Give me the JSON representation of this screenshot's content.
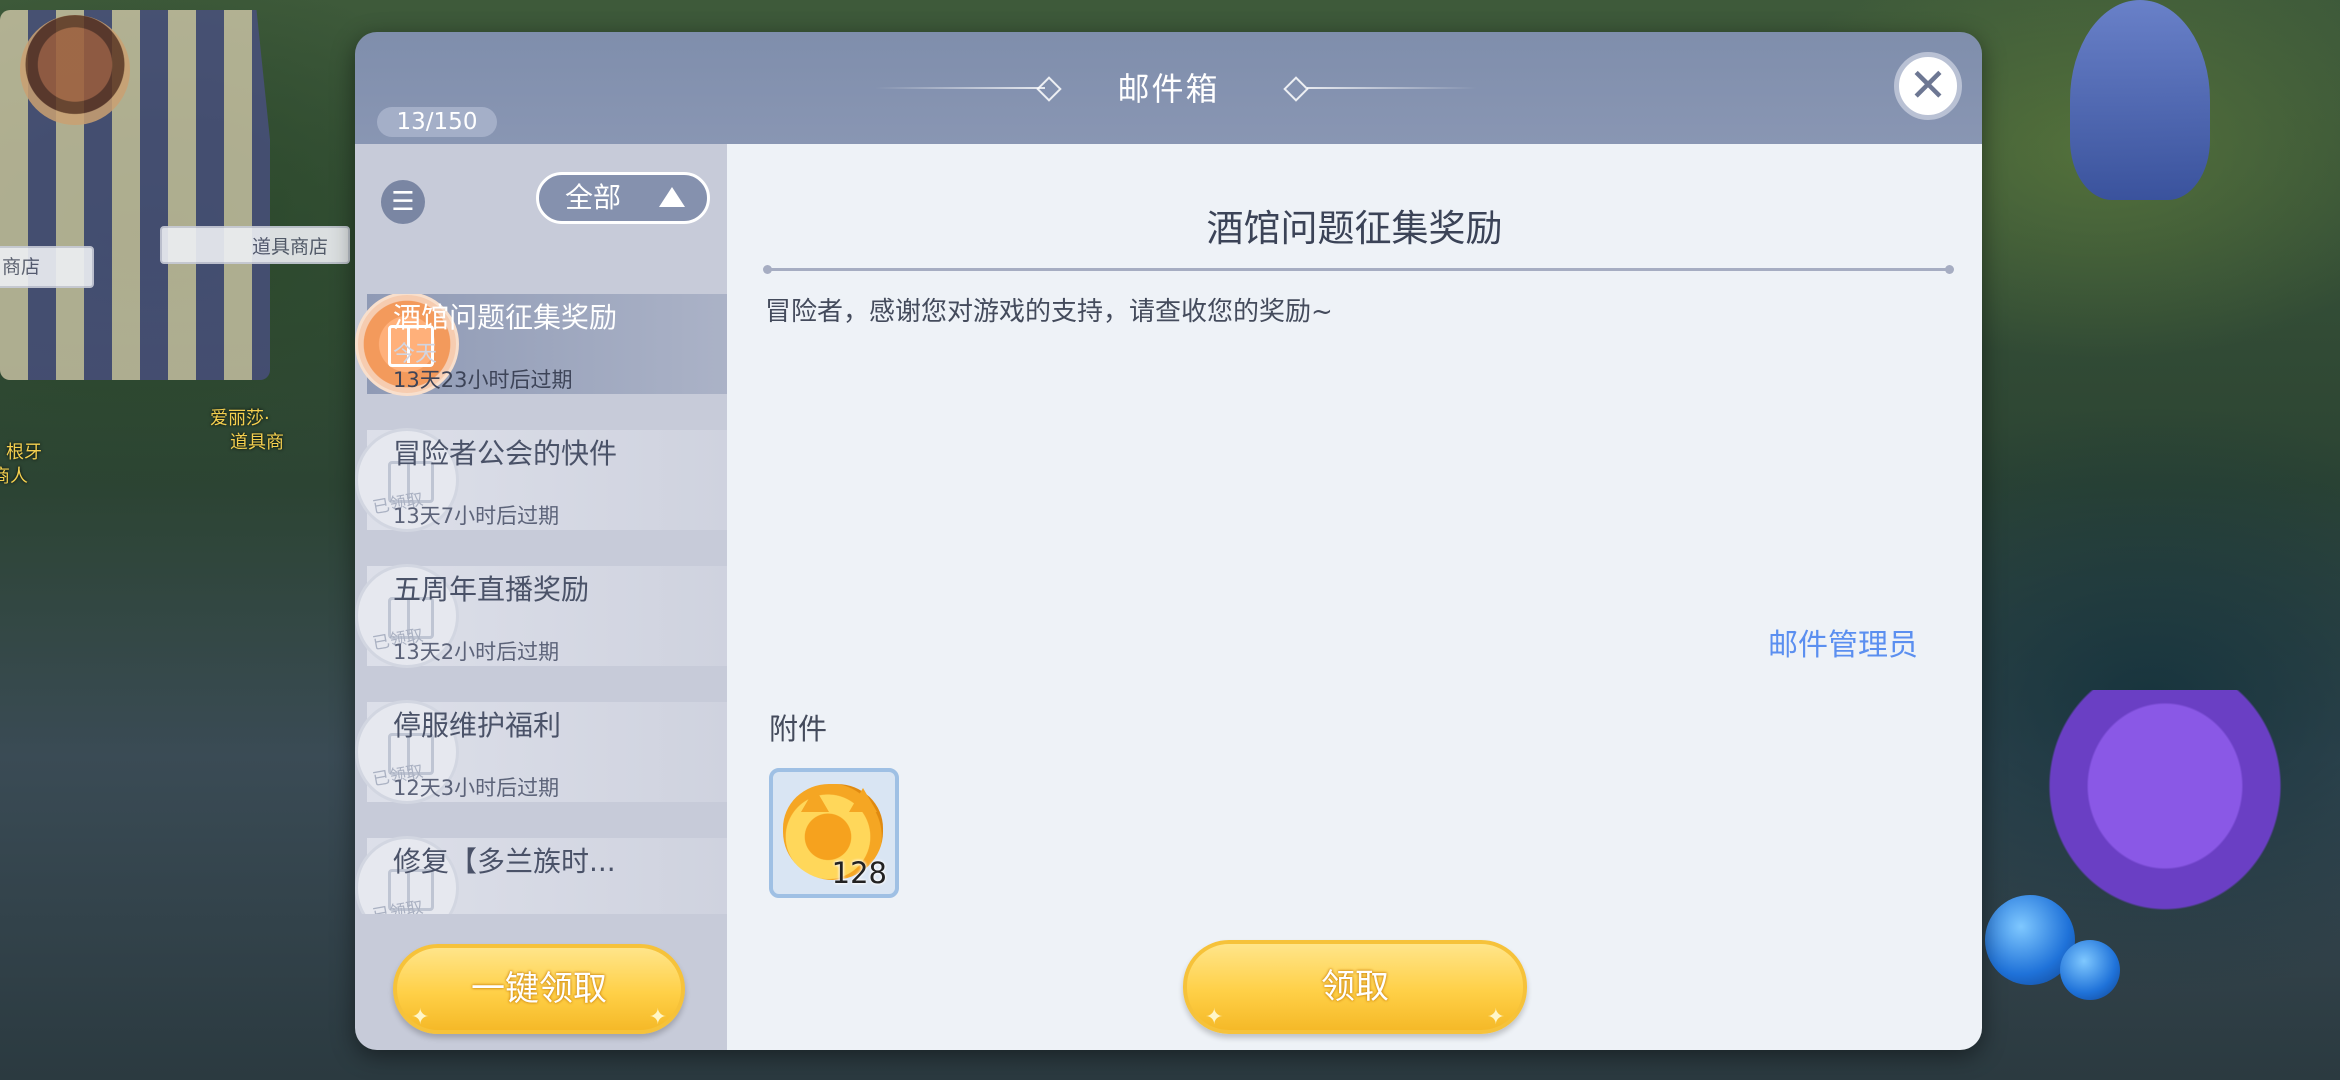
{
  "background": {
    "signs": [
      "商店",
      "道具商店"
    ],
    "npc_labels": [
      "爱丽莎·",
      "道具商",
      "根牙",
      "商人"
    ]
  },
  "dialog": {
    "title": "邮件箱",
    "mail_count": "13/150",
    "close_label": "✕"
  },
  "sidebar": {
    "filter_label": "全部",
    "list_icon": "list-icon",
    "claim_all_label": "一键领取",
    "mails": [
      {
        "title": "酒馆问题征集奖励",
        "date": "今天",
        "expiry": "13天23小时后过期",
        "claimed": false,
        "selected": true
      },
      {
        "title": "冒险者公会的快件",
        "date": "",
        "expiry": "13天7小时后过期",
        "claimed": true,
        "stamp": "已领取"
      },
      {
        "title": "五周年直播奖励",
        "date": "",
        "expiry": "13天2小时后过期",
        "claimed": true,
        "stamp": "已领取"
      },
      {
        "title": "停服维护福利",
        "date": "",
        "expiry": "12天3小时后过期",
        "claimed": true,
        "stamp": "已领取"
      },
      {
        "title": "修复【多兰族时...",
        "date": "",
        "expiry": "",
        "claimed": true,
        "stamp": "已领取"
      }
    ]
  },
  "content": {
    "title": "酒馆问题征集奖励",
    "body": "冒险者，感谢您对游戏的支持，请查收您的奖励~",
    "sender": "邮件管理员",
    "attachment_label": "附件",
    "attachment": {
      "icon": "cat-coin-icon",
      "quantity": "128"
    },
    "claim_label": "领取"
  },
  "colors": {
    "header": "#8693b0",
    "sidebar": "#c7cbd9",
    "content_bg": "#eef2f7",
    "accent_gold": "#ffd047",
    "sender_blue": "#5b8ff0"
  }
}
